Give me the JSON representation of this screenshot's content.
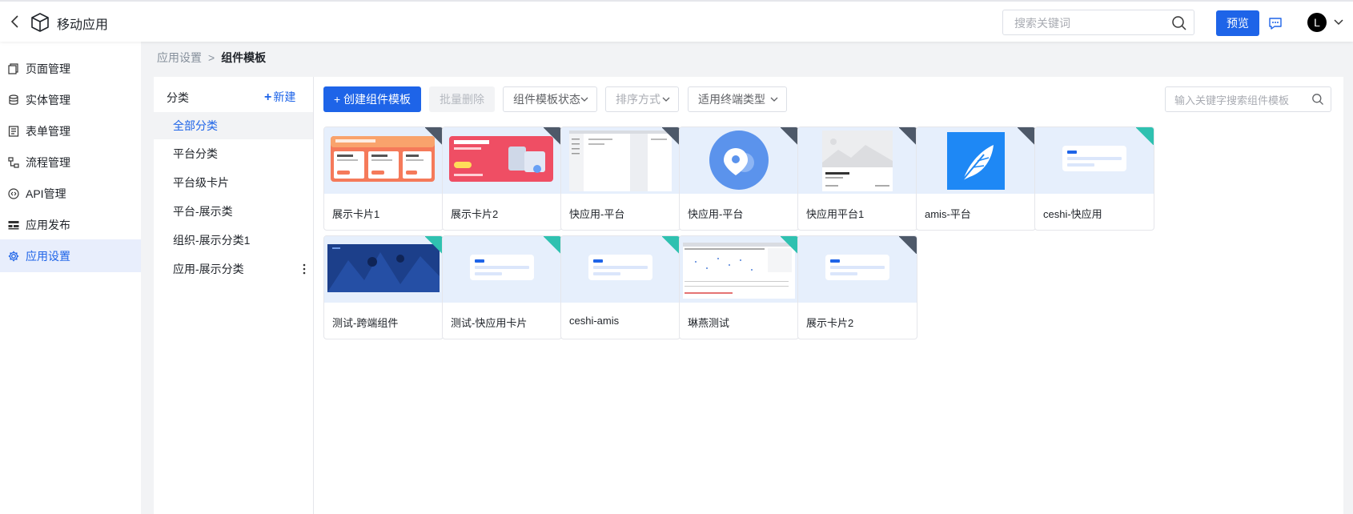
{
  "header": {
    "app_title": "移动应用",
    "search_placeholder": "搜索关键词",
    "preview_label": "预览",
    "avatar_letter": "L"
  },
  "sidebar": {
    "items": [
      {
        "label": "页面管理",
        "icon": "page-icon"
      },
      {
        "label": "实体管理",
        "icon": "database-icon"
      },
      {
        "label": "表单管理",
        "icon": "form-icon"
      },
      {
        "label": "流程管理",
        "icon": "flow-icon"
      },
      {
        "label": "API管理",
        "icon": "api-icon"
      },
      {
        "label": "应用发布",
        "icon": "publish-icon"
      },
      {
        "label": "应用设置",
        "icon": "gear-icon",
        "active": true
      }
    ]
  },
  "breadcrumb": {
    "parent": "应用设置",
    "separator": ">",
    "current": "组件模板"
  },
  "categories": {
    "header": "分类",
    "new_label": "新建",
    "items": [
      {
        "label": "全部分类",
        "active": true
      },
      {
        "label": "平台分类"
      },
      {
        "label": "平台级卡片"
      },
      {
        "label": "平台-展示类"
      },
      {
        "label": "组织-展示分类1"
      },
      {
        "label": "应用-展示分类"
      }
    ]
  },
  "toolbar": {
    "create_label": "+ 创建组件模板",
    "batch_delete_label": "批量删除",
    "status_filter": "组件模板状态",
    "sort_filter": "排序方式",
    "terminal_filter": "适用终端类型",
    "search_placeholder": "输入关键字搜索组件模板"
  },
  "cards": [
    {
      "name": "展示卡片1",
      "thumb": "promo-orange",
      "badge": "dark"
    },
    {
      "name": "展示卡片2",
      "thumb": "promo-red",
      "badge": "dark"
    },
    {
      "name": "快应用-平台",
      "thumb": "screenshot-doc",
      "badge": "dark"
    },
    {
      "name": "快应用-平台",
      "thumb": "pin-circle",
      "badge": "dark"
    },
    {
      "name": "快应用平台1",
      "thumb": "image-card",
      "badge": "dark"
    },
    {
      "name": "amis-平台",
      "thumb": "feather",
      "badge": "dark"
    },
    {
      "name": "ceshi-快应用",
      "thumb": "skeleton",
      "badge": "green"
    },
    {
      "name": "测试-跨端组件",
      "thumb": "dark-photo",
      "badge": "green"
    },
    {
      "name": "测试-快应用卡片",
      "thumb": "skeleton",
      "badge": "green"
    },
    {
      "name": "ceshi-amis",
      "thumb": "skeleton",
      "badge": "green"
    },
    {
      "name": "琳燕测试",
      "thumb": "screenshot-chart",
      "badge": "green"
    },
    {
      "name": "展示卡片2",
      "thumb": "skeleton",
      "badge": "dark"
    }
  ],
  "colors": {
    "primary": "#1e64e8",
    "badge_dark": "#4e5969",
    "badge_green": "#2fc1b0"
  }
}
